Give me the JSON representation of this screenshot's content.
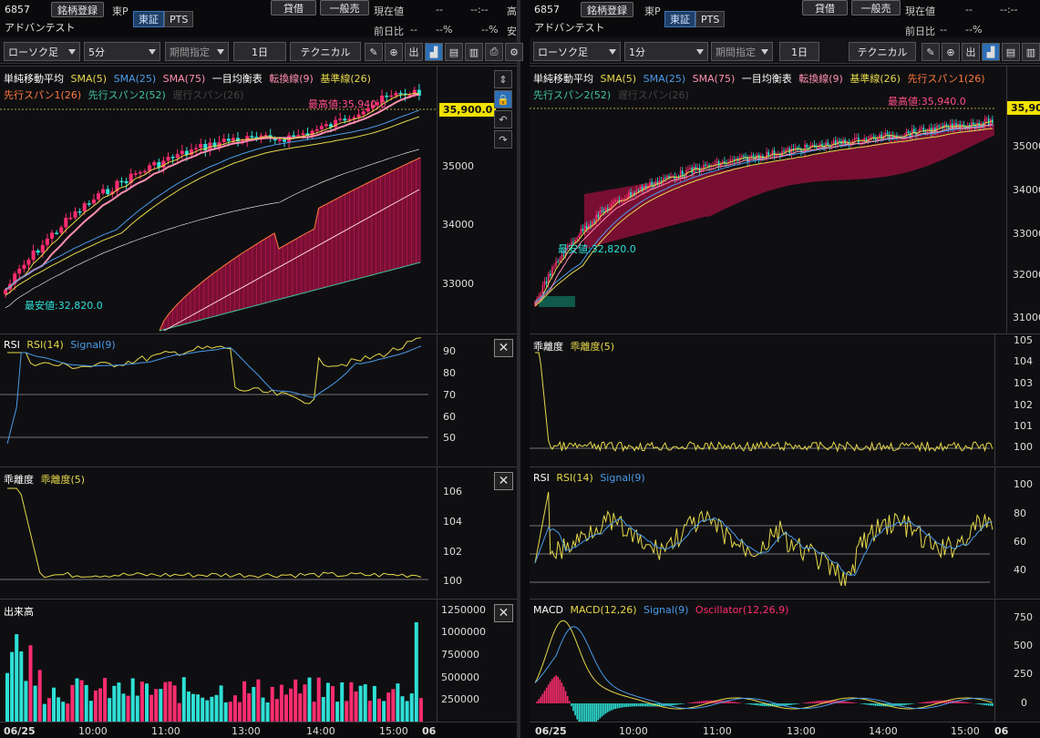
{
  "left": {
    "header": {
      "code": "6857",
      "watch_btn": "銘柄登録",
      "exchange": "東P",
      "markets": [
        "東証",
        "PTS"
      ],
      "lend_btn": "貸借",
      "general_btn": "一般売",
      "current_label": "現在値",
      "current_value": "--",
      "current_time": "--:--",
      "name": "アドバンテスト",
      "prev_label": "前日比",
      "prev_value": "--",
      "prev_pct": "--%",
      "pct": "--%",
      "high_label": "高",
      "cheap_label": "安"
    },
    "toolbar": {
      "chart_type": "ローソク足",
      "interval": "5分",
      "period": "期間指定",
      "span": "1日",
      "technical": "テクニカル"
    },
    "main_legend": [
      "単純移動平均",
      "SMA(5)",
      "SMA(25)",
      "SMA(75)",
      "一目均衡表",
      "転換線(9)",
      "基準線(26)",
      "先行スパン1(26)",
      "先行スパン2(52)",
      "遅行スパン(26)"
    ],
    "high_label": "最高値:35,940.0",
    "low_label": "最安値:32,820.0",
    "price_box": "35,900.0",
    "price_ticks": [
      "35000",
      "34000",
      "33000"
    ],
    "rsi": {
      "legend": [
        "RSI",
        "RSI(14)",
        "Signal(9)"
      ],
      "ticks": [
        "90",
        "80",
        "70",
        "60",
        "50"
      ]
    },
    "dev": {
      "legend": [
        "乖離度",
        "乖離度(5)"
      ],
      "ticks": [
        "106",
        "104",
        "102",
        "100"
      ]
    },
    "vol": {
      "legend": [
        "出来高"
      ],
      "ticks": [
        "1250000",
        "1000000",
        "750000",
        "500000",
        "250000"
      ]
    },
    "xaxis": [
      "06/25",
      "10:00",
      "11:00",
      "13:00",
      "14:00",
      "15:00",
      "06"
    ]
  },
  "right": {
    "header": {
      "code": "6857",
      "watch_btn": "銘柄登録",
      "exchange": "東P",
      "markets": [
        "東証",
        "PTS"
      ],
      "lend_btn": "貸借",
      "general_btn": "一般売",
      "current_label": "現在値",
      "current_value": "--",
      "current_time": "--:--",
      "name": "アドバンテスト",
      "prev_label": "前日比",
      "prev_value": "--",
      "prev_pct": "--%"
    },
    "toolbar": {
      "chart_type": "ローソク足",
      "interval": "1分",
      "period": "期間指定",
      "span": "1日",
      "technical": "テクニカル"
    },
    "main_legend": [
      "単純移動平均",
      "SMA(5)",
      "SMA(25)",
      "SMA(75)",
      "一目均衡表",
      "転換線(9)",
      "基準線(26)",
      "先行スパン1(26)",
      "先行スパン2(52)",
      "遅行スパン(26)"
    ],
    "high_label": "最高値:35,940.0",
    "low_label": "最安値:32,820.0",
    "price_box": "35,90",
    "price_ticks": [
      "35000",
      "34000",
      "33000",
      "32000",
      "31000"
    ],
    "dev": {
      "legend": [
        "乖離度",
        "乖離度(5)"
      ],
      "ticks": [
        "105",
        "104",
        "103",
        "102",
        "101",
        "100"
      ]
    },
    "rsi": {
      "legend": [
        "RSI",
        "RSI(14)",
        "Signal(9)"
      ],
      "ticks": [
        "100",
        "80",
        "60",
        "40"
      ]
    },
    "macd": {
      "legend": [
        "MACD",
        "MACD(12,26)",
        "Signal(9)",
        "Oscillator(12,26,9)"
      ],
      "ticks": [
        "750",
        "500",
        "250",
        "0"
      ]
    },
    "xaxis": [
      "06/25",
      "10:00",
      "11:00",
      "13:00",
      "14:00",
      "15:00",
      "06"
    ]
  },
  "colors": {
    "sma5": "#e6d84a",
    "sma25": "#4a9be8",
    "sma75": "#ff8fb0",
    "tenkan": "#ff8fb0",
    "kijun": "#e6d84a",
    "span1": "#ff7a3d",
    "span2": "#3fc79a",
    "up": "#ff2d6f",
    "down": "#2ee0d6",
    "kumo": "#8b0f3a"
  }
}
